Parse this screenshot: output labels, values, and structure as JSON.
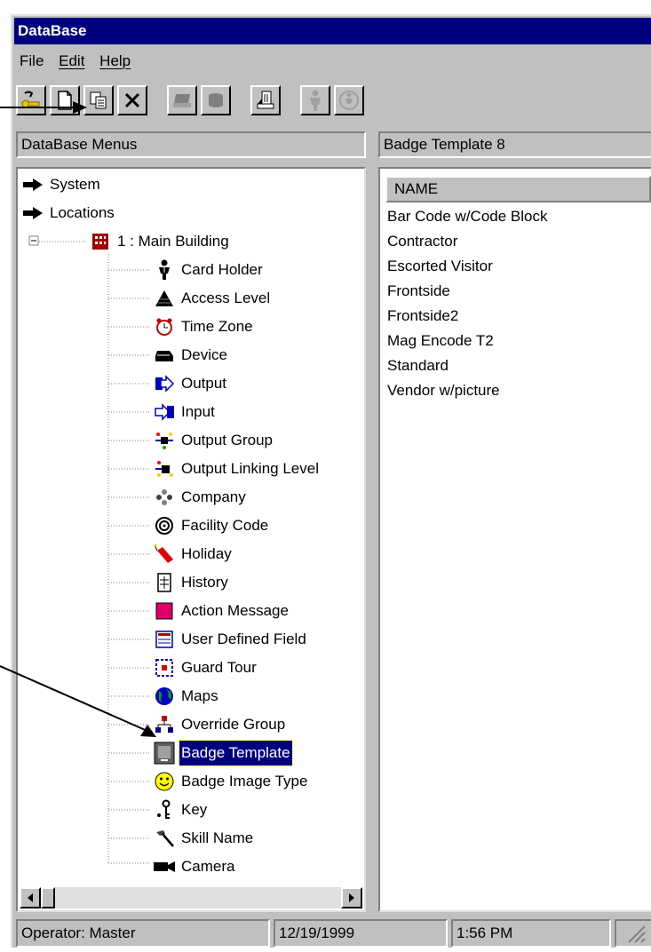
{
  "window": {
    "title": "DataBase"
  },
  "menu": {
    "file": "File",
    "edit": "Edit",
    "help": "Help"
  },
  "toolbar": {
    "buttons": [
      "key-icon",
      "new-record-icon",
      "copy-icon",
      "delete-icon",
      "print-icon",
      "badge-print-icon",
      "report-icon",
      "person-icon",
      "person-disabled-icon"
    ]
  },
  "left_pane": {
    "header": "DataBase Menus",
    "tree": [
      {
        "label": "System",
        "icon": "arrow-right-icon"
      },
      {
        "label": "Locations",
        "icon": "arrow-right-icon"
      },
      {
        "label": "1 : Main Building",
        "icon": "building-icon"
      },
      {
        "label": "Card Holder",
        "icon": "card-holder-icon"
      },
      {
        "label": "Access Level",
        "icon": "access-level-icon"
      },
      {
        "label": "Time Zone",
        "icon": "alarm-clock-icon"
      },
      {
        "label": "Device",
        "icon": "device-icon"
      },
      {
        "label": "Output",
        "icon": "output-arrow-icon"
      },
      {
        "label": "Input",
        "icon": "input-arrow-icon"
      },
      {
        "label": "Output Group",
        "icon": "output-group-icon"
      },
      {
        "label": "Output Linking Level",
        "icon": "output-linking-icon"
      },
      {
        "label": "Company",
        "icon": "company-icon"
      },
      {
        "label": "Facility Code",
        "icon": "facility-code-icon"
      },
      {
        "label": "Holiday",
        "icon": "holiday-icon"
      },
      {
        "label": "History",
        "icon": "history-icon"
      },
      {
        "label": "Action Message",
        "icon": "action-message-icon"
      },
      {
        "label": "User Defined Field",
        "icon": "user-defined-field-icon"
      },
      {
        "label": "Guard Tour",
        "icon": "guard-tour-icon"
      },
      {
        "label": "Maps",
        "icon": "globe-icon"
      },
      {
        "label": "Override Group",
        "icon": "override-group-icon"
      },
      {
        "label": "Badge Template",
        "icon": "badge-template-icon",
        "selected": true
      },
      {
        "label": "Badge Image Type",
        "icon": "smiley-icon"
      },
      {
        "label": "Key",
        "icon": "key-icon"
      },
      {
        "label": "Skill Name",
        "icon": "hammer-icon"
      },
      {
        "label": "Camera",
        "icon": "camera-icon"
      }
    ]
  },
  "right_pane": {
    "header": "Badge Template   8",
    "column_header": "NAME",
    "items": [
      "Bar Code w/Code Block",
      "Contractor",
      "Escorted Visitor",
      "Frontside",
      "Frontside2",
      "Mag Encode T2",
      "Standard",
      "Vendor w/picture"
    ]
  },
  "status": {
    "operator": "Operator:  Master",
    "date": "12/19/1999",
    "time": "1:56 PM"
  },
  "colors": {
    "title_bar": "#000080",
    "window_face": "#c0c0c0",
    "selection": "#000080"
  }
}
